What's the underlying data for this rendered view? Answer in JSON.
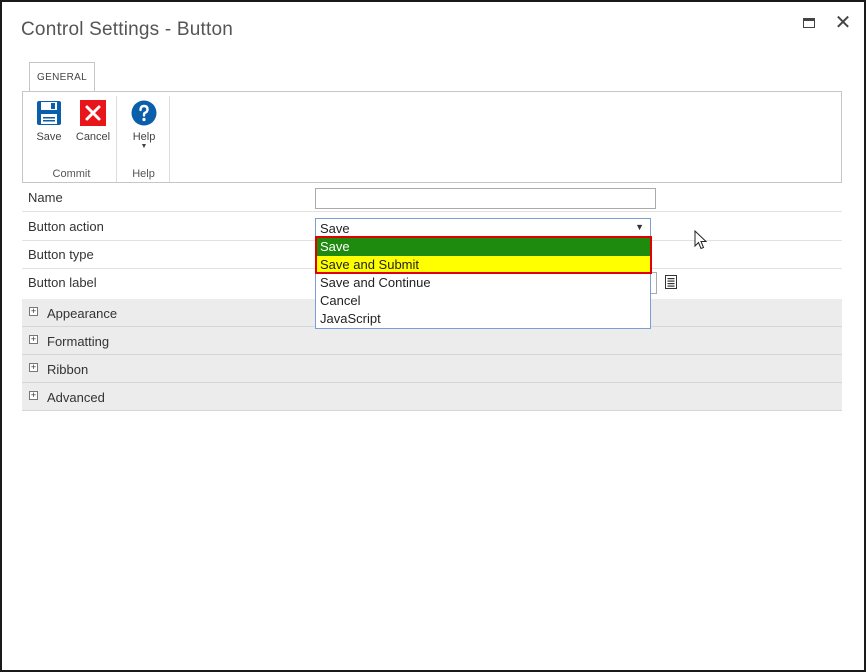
{
  "window": {
    "title": "Control Settings - Button",
    "maximize_label": "",
    "close_glyph": "✕"
  },
  "ribbon": {
    "tab": "GENERAL",
    "groups": {
      "commit": {
        "label": "Commit",
        "save_label": "Save",
        "cancel_label": "Cancel"
      },
      "help": {
        "label": "Help",
        "help_label": "Help"
      }
    },
    "icons": {
      "save": "floppy-disk-icon",
      "cancel": "red-x-icon",
      "help": "question-circle-icon"
    },
    "colors": {
      "save_icon": "#0b5eaa",
      "cancel_icon": "#e8151b",
      "help_icon": "#0b5eaa"
    }
  },
  "form": {
    "name_label": "Name",
    "name_value": "",
    "button_action_label": "Button action",
    "button_action_value": "Save",
    "button_type_label": "Button type",
    "button_label_label": "Button label",
    "dropdown_arrow": "▼",
    "options": [
      "Save",
      "Save and Submit",
      "Save and Continue",
      "Cancel",
      "JavaScript"
    ],
    "selected_option": "Save",
    "highlighted_option": "Save and Submit"
  },
  "sections": {
    "expand_glyph": "+",
    "appearance": "Appearance",
    "formatting": "Formatting",
    "ribbon": "Ribbon",
    "advanced": "Advanced"
  },
  "colors": {
    "selected_option_bg": "#1e8a0e",
    "highlighted_option_bg": "#ffff00",
    "annotation_border": "#e00000"
  }
}
